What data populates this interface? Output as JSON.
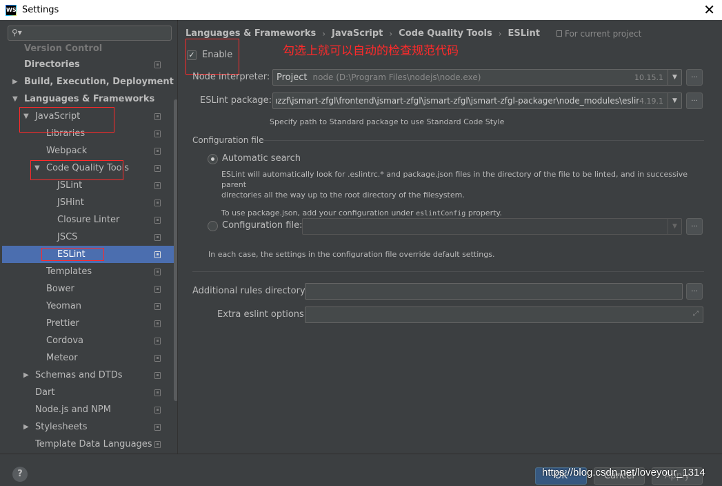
{
  "window": {
    "title": "Settings",
    "logo_text": "WS"
  },
  "sidebar": {
    "search_placeholder": "",
    "items": [
      {
        "label": "Version Control"
      },
      {
        "label": "Directories"
      },
      {
        "label": "Build, Execution, Deployment"
      },
      {
        "label": "Languages & Frameworks"
      },
      {
        "label": "JavaScript"
      },
      {
        "label": "Libraries"
      },
      {
        "label": "Webpack"
      },
      {
        "label": "Code Quality Tools"
      },
      {
        "label": "JSLint"
      },
      {
        "label": "JSHint"
      },
      {
        "label": "Closure Linter"
      },
      {
        "label": "JSCS"
      },
      {
        "label": "ESLint"
      },
      {
        "label": "Templates"
      },
      {
        "label": "Bower"
      },
      {
        "label": "Yeoman"
      },
      {
        "label": "Prettier"
      },
      {
        "label": "Cordova"
      },
      {
        "label": "Meteor"
      },
      {
        "label": "Schemas and DTDs"
      },
      {
        "label": "Dart"
      },
      {
        "label": "Node.js and NPM"
      },
      {
        "label": "Stylesheets"
      },
      {
        "label": "Template Data Languages"
      }
    ],
    "selected": "ESLint"
  },
  "breadcrumb": {
    "items": [
      "Languages & Frameworks",
      "JavaScript",
      "Code Quality Tools",
      "ESLint"
    ],
    "scope": "For current project"
  },
  "eslint": {
    "enable_label": "Enable",
    "enabled": true,
    "annotation": "勾选上就可以自动的检查规范代码",
    "node_interpreter_label": "Node interpreter:",
    "node_interpreter_prefix": "Project",
    "node_interpreter_value": "node (D:\\Program Files\\nodejs\\node.exe)",
    "node_version": "10.15.1",
    "package_label": "ESLint package:",
    "package_value": "ızzf\\jsmart-zfgl\\frontend\\jsmart-zfgl\\jsmart-zfgl\\jsmart-zfgl-packager\\node_modules\\eslint",
    "package_version": "4.19.1",
    "package_hint": "Specify path to Standard package to use Standard Code Style",
    "config_section": "Configuration file",
    "auto_search_label": "Automatic search",
    "auto_search_selected": true,
    "auto_desc_line1": "ESLint will automatically look for .eslintrc.* and package.json files in the directory of the file to be linted, and in successive parent",
    "auto_desc_line2": "directories all the way up to the root directory of the filesystem.",
    "auto_desc_line3_pre": "To use package.json, add your configuration under ",
    "auto_desc_line3_code": "eslintConfig",
    "auto_desc_line3_post": " property.",
    "config_file_label": "Configuration file:",
    "config_file_value": "",
    "override_note": "In each case, the settings in the configuration file override default settings.",
    "rules_dir_label": "Additional rules directory:",
    "rules_dir_value": "",
    "extra_options_label": "Extra eslint options:",
    "extra_options_value": "",
    "browse_label": "..."
  },
  "footer": {
    "help_label": "?",
    "ok_label": "OK",
    "cancel_label": "Cancel",
    "apply_label": "Apply",
    "watermark": "https://blog.csdn.net/loveyour_1314"
  },
  "colors": {
    "selection": "#4b6eaf",
    "annotation_red": "#ff2a2a",
    "background": "#3c3f41"
  }
}
